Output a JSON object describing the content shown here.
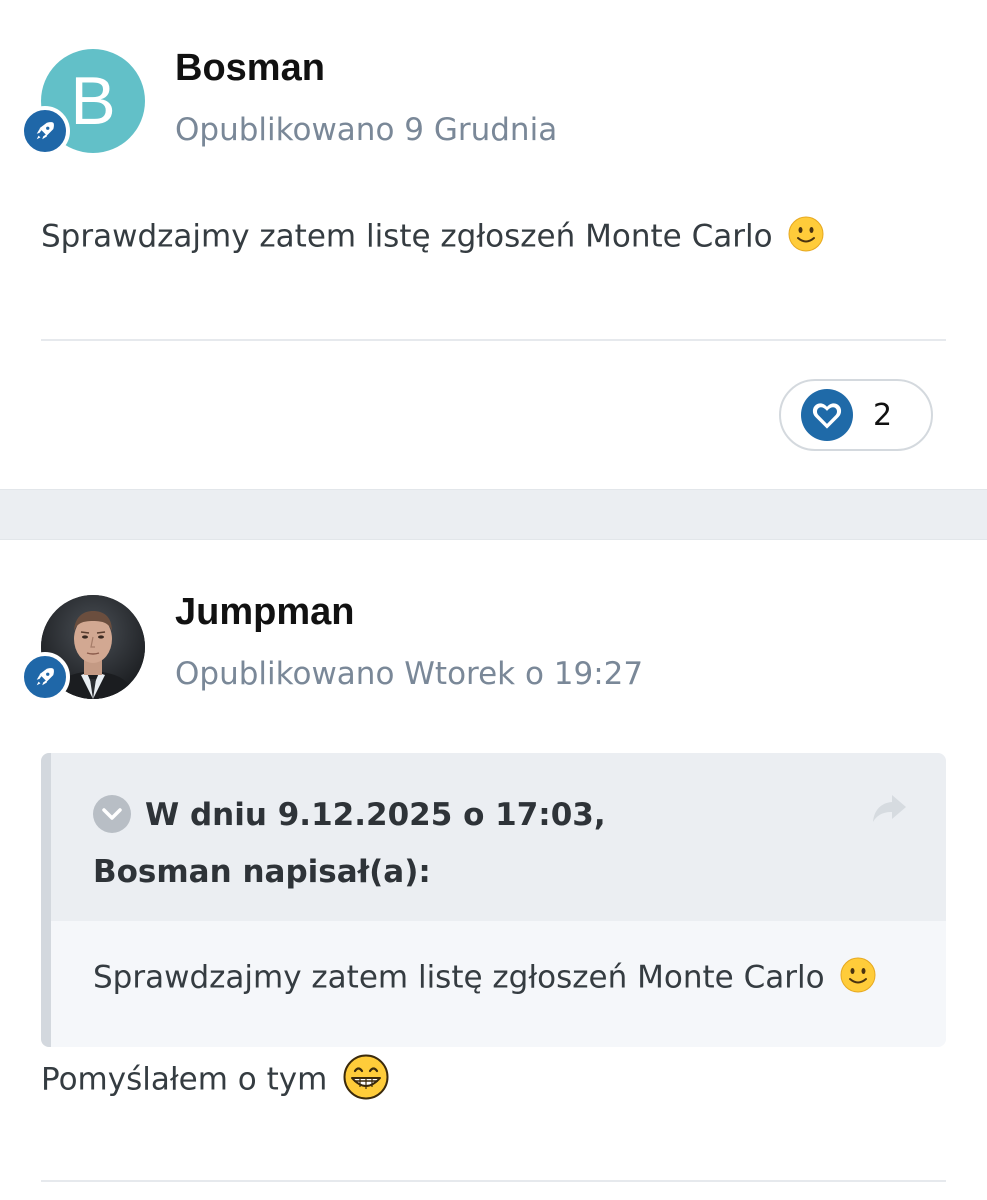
{
  "posts": [
    {
      "avatar_letter": "B",
      "avatar_color": "#62c0c8",
      "badge_icon": "rocket-icon",
      "author": "Bosman",
      "meta": "Opublikowano 9 Grudnia",
      "text": "Sprawdzajmy zatem listę zgłoszeń Monte Carlo",
      "text_emoji": "slightly-smiling-face-emoji",
      "reaction": {
        "icon": "heart-icon",
        "count": "2"
      }
    },
    {
      "avatar_type": "photo",
      "badge_icon": "rocket-icon",
      "author": "Jumpman",
      "meta": "Opublikowano Wtorek o 19:27",
      "quote": {
        "title": "W dniu 9.12.2025 o 17:03, Bosman napisał(a):",
        "toggle_icon": "chevron-down-icon",
        "share_icon": "share-arrow-icon",
        "text": "Sprawdzajmy zatem listę zgłoszeń Monte Carlo",
        "text_emoji": "slightly-smiling-face-emoji"
      },
      "text": "Pomyślałem o tym",
      "text_emoji": "grinning-face-emoji"
    }
  ],
  "colors": {
    "accent": "#1f67a8",
    "meta_text": "#7a8898",
    "separator": "#ebeef2"
  }
}
